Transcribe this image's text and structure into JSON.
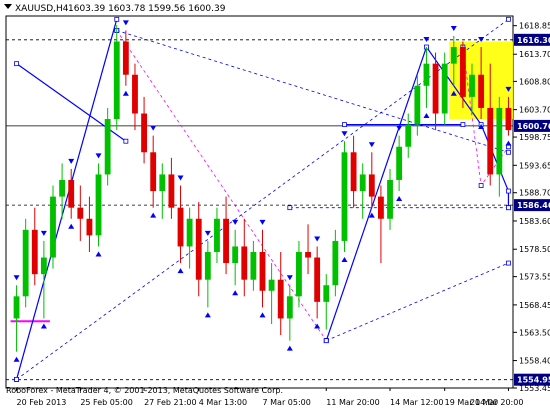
{
  "header": {
    "symbol": "XAUUSD,H4",
    "ohlc": "1603.39 1603.78 1599.56 1600.39"
  },
  "footer": {
    "copyright": "RoboForex - MetaTrader 4, © 2001-2013, MetaQuotes Software Corp."
  },
  "price_labels": {
    "top_dashed": "1616.30",
    "mid_line": "1600.76",
    "support": "1586.46",
    "bottom": "1554.95"
  },
  "colors": {
    "bull": "#00c000",
    "bear": "#e00000",
    "trend": "#0000ff",
    "fib": "#ff00ff",
    "zone": "#ffff00",
    "label_bg": "#000080"
  },
  "chart_data": {
    "type": "candlestick",
    "symbol": "XAUUSD",
    "timeframe": "H4",
    "ylim": [
      1553.45,
      1620.6
    ],
    "y_ticks": [
      1618.85,
      1613.7,
      1608.8,
      1603.7,
      1598.75,
      1593.65,
      1588.7,
      1583.6,
      1578.5,
      1573.55,
      1568.45,
      1563.5,
      1558.4,
      1553.45
    ],
    "x_ticks": [
      "20 Feb 2013",
      "25 Feb 05:00",
      "27 Feb 21:00",
      "4 Mar 13:00",
      "7 Mar 05:00",
      "11 Mar 20:00",
      "14 Mar 12:00",
      "19 Mar 04:00",
      "21 Mar 20:00"
    ],
    "horizontal_levels": [
      1616.3,
      1600.76,
      1586.46,
      1554.95
    ],
    "candles": [
      [
        1566,
        1572,
        1560,
        1570
      ],
      [
        1570,
        1584,
        1568,
        1582
      ],
      [
        1582,
        1586,
        1572,
        1574
      ],
      [
        1574,
        1580,
        1566,
        1577
      ],
      [
        1577,
        1590,
        1575,
        1588
      ],
      [
        1588,
        1594,
        1584,
        1591
      ],
      [
        1591,
        1593,
        1584,
        1586
      ],
      [
        1586,
        1590,
        1580,
        1584
      ],
      [
        1584,
        1588,
        1578,
        1581
      ],
      [
        1581,
        1594,
        1579,
        1592
      ],
      [
        1592,
        1604,
        1590,
        1602
      ],
      [
        1602,
        1619,
        1600,
        1616
      ],
      [
        1616,
        1618,
        1608,
        1610
      ],
      [
        1610,
        1612,
        1600,
        1603
      ],
      [
        1603,
        1606,
        1594,
        1596
      ],
      [
        1596,
        1599,
        1586,
        1589
      ],
      [
        1589,
        1594,
        1584,
        1592
      ],
      [
        1592,
        1595,
        1584,
        1586
      ],
      [
        1586,
        1590,
        1576,
        1579
      ],
      [
        1579,
        1586,
        1575,
        1584
      ],
      [
        1584,
        1587,
        1570,
        1573
      ],
      [
        1573,
        1580,
        1568,
        1578
      ],
      [
        1578,
        1586,
        1576,
        1584
      ],
      [
        1584,
        1588,
        1574,
        1576
      ],
      [
        1576,
        1582,
        1572,
        1579
      ],
      [
        1579,
        1584,
        1570,
        1573
      ],
      [
        1573,
        1580,
        1571,
        1578
      ],
      [
        1578,
        1582,
        1568,
        1571
      ],
      [
        1571,
        1576,
        1565,
        1573
      ],
      [
        1573,
        1578,
        1563,
        1566
      ],
      [
        1566,
        1572,
        1562,
        1570
      ],
      [
        1570,
        1580,
        1568,
        1578
      ],
      [
        1578,
        1583,
        1574,
        1577
      ],
      [
        1577,
        1579,
        1566,
        1569
      ],
      [
        1569,
        1574,
        1564,
        1572
      ],
      [
        1572,
        1582,
        1570,
        1580
      ],
      [
        1580,
        1598,
        1578,
        1596
      ],
      [
        1596,
        1599,
        1586,
        1589
      ],
      [
        1589,
        1594,
        1584,
        1592
      ],
      [
        1592,
        1596,
        1586,
        1588
      ],
      [
        1588,
        1590,
        1576,
        1584
      ],
      [
        1584,
        1593,
        1582,
        1591
      ],
      [
        1591,
        1599,
        1589,
        1597
      ],
      [
        1597,
        1603,
        1595,
        1601
      ],
      [
        1601,
        1610,
        1599,
        1608
      ],
      [
        1608,
        1615,
        1604,
        1612
      ],
      [
        1612,
        1614,
        1600,
        1603
      ],
      [
        1603,
        1614,
        1601,
        1612
      ],
      [
        1612,
        1617,
        1608,
        1615
      ],
      [
        1615,
        1616,
        1604,
        1606
      ],
      [
        1606,
        1612,
        1603,
        1610
      ],
      [
        1610,
        1615,
        1602,
        1604
      ],
      [
        1604,
        1612,
        1590,
        1592
      ],
      [
        1592,
        1606,
        1588,
        1604
      ],
      [
        1604,
        1606,
        1599,
        1600
      ]
    ],
    "segments": [
      {
        "kind": "trend",
        "pts": [
          [
            0,
            1555
          ],
          [
            11,
            1620
          ]
        ]
      },
      {
        "kind": "trend",
        "pts": [
          [
            34,
            1562
          ],
          [
            45,
            1615
          ],
          [
            51,
            1601
          ],
          [
            54,
            1589
          ],
          [
            54,
            1586
          ]
        ]
      },
      {
        "kind": "trend",
        "pts": [
          [
            0,
            1612
          ],
          [
            12,
            1598
          ]
        ]
      },
      {
        "kind": "trend",
        "pts": [
          [
            36,
            1601
          ],
          [
            49,
            1601
          ]
        ]
      },
      {
        "kind": "fib",
        "pts": [
          [
            11,
            1618
          ],
          [
            34,
            1562
          ]
        ]
      },
      {
        "kind": "fib",
        "pts": [
          [
            49,
            1615
          ],
          [
            51,
            1590
          ],
          [
            54,
            1597
          ]
        ]
      },
      {
        "kind": "dashed",
        "pts": [
          [
            11,
            1618
          ],
          [
            54,
            1596
          ]
        ]
      },
      {
        "kind": "dashed",
        "pts": [
          [
            34,
            1562
          ],
          [
            54,
            1576
          ]
        ]
      },
      {
        "kind": "dashed",
        "pts": [
          [
            0,
            1555
          ],
          [
            54,
            1620
          ]
        ]
      },
      {
        "kind": "dashed",
        "pts": [
          [
            30,
            1586
          ],
          [
            54,
            1586
          ]
        ]
      }
    ],
    "magenta_level": {
      "price": 1565.5,
      "from": 0,
      "to": 3
    },
    "zone": {
      "from": 48,
      "to": 54,
      "top": 1616,
      "bottom": 1602
    }
  }
}
